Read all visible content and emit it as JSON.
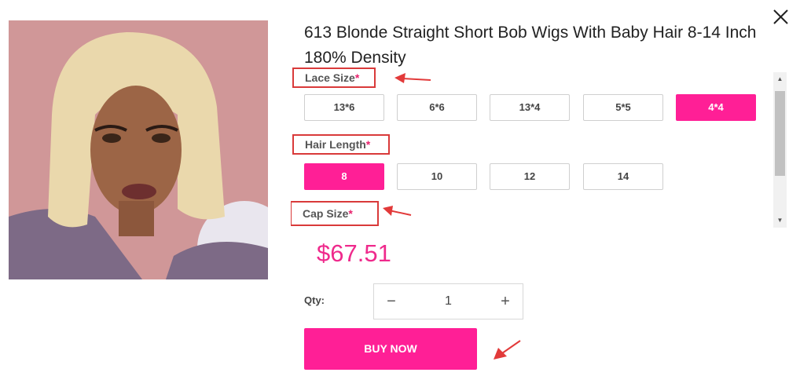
{
  "icons": {
    "close": "close-icon",
    "minus": "minus-icon",
    "plus": "plus-icon",
    "scroll_up": "scroll-up-arrow-icon",
    "scroll_down": "scroll-down-arrow-icon",
    "annotation_arrow": "annotation-arrow-icon"
  },
  "colors": {
    "accent": "#ff1f96",
    "price": "#ef2a8c",
    "annotation": "#d93a3a"
  },
  "product": {
    "title": "613 Blonde Straight Short Bob Wigs With Baby Hair 8-14 Inch 180% Density",
    "price": "$67.51"
  },
  "options": {
    "lace_size": {
      "label": "Lace Size",
      "required_mark": "*",
      "values": [
        "13*6",
        "6*6",
        "13*4",
        "5*5",
        "4*4"
      ],
      "selected": "4*4"
    },
    "hair_length": {
      "label": "Hair Length",
      "required_mark": "*",
      "values": [
        "8",
        "10",
        "12",
        "14"
      ],
      "selected": "8"
    },
    "cap_size": {
      "label": "Cap Size",
      "required_mark": "*"
    }
  },
  "qty": {
    "label": "Qty:",
    "value": "1",
    "minus": "−",
    "plus": "+"
  },
  "buy_button": {
    "label": "BUY NOW"
  },
  "scrollbar": {
    "up": "▲",
    "down": "▼"
  }
}
